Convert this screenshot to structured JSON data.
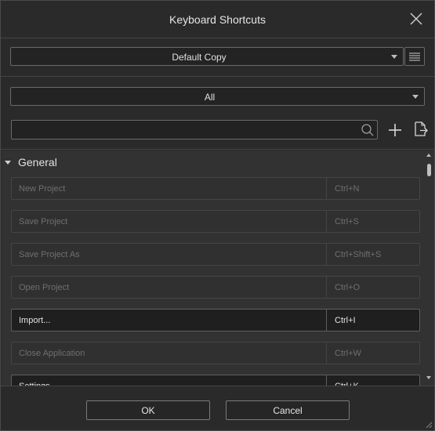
{
  "dialog": {
    "title": "Keyboard Shortcuts"
  },
  "preset": {
    "selected": "Default Copy"
  },
  "filter": {
    "selected": "All"
  },
  "search": {
    "value": "",
    "placeholder": ""
  },
  "groups": [
    {
      "label": "General",
      "rows": [
        {
          "name": "New Project",
          "shortcut": "Ctrl+N"
        },
        {
          "name": "Save Project",
          "shortcut": "Ctrl+S"
        },
        {
          "name": "Save Project As",
          "shortcut": "Ctrl+Shift+S"
        },
        {
          "name": "Open Project",
          "shortcut": "Ctrl+O"
        },
        {
          "name": "Import...",
          "shortcut": "Ctrl+I"
        },
        {
          "name": "Close Application",
          "shortcut": "Ctrl+W"
        },
        {
          "name": "Settings",
          "shortcut": "Ctrl+K"
        }
      ]
    }
  ],
  "footer": {
    "ok_label": "OK",
    "cancel_label": "Cancel"
  },
  "icons": {
    "close": "close-icon",
    "menu": "hamburger-menu-icon",
    "search": "search-icon",
    "add": "plus-icon",
    "export": "export-file-icon"
  }
}
